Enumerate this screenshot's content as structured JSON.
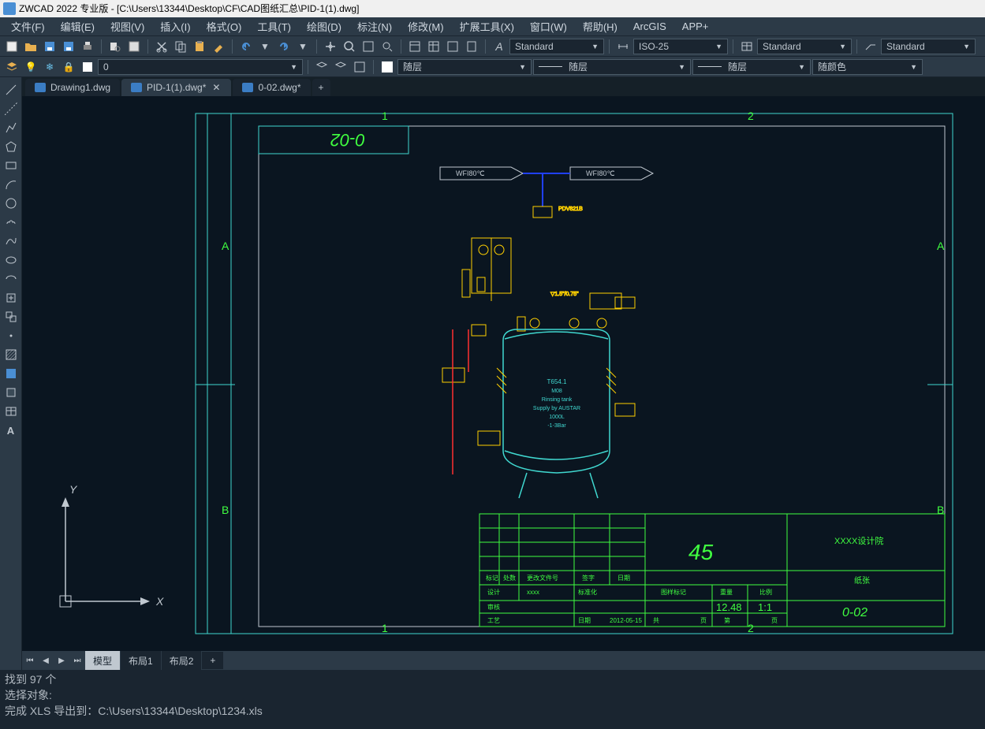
{
  "title": "ZWCAD 2022 专业版 - [C:\\Users\\13344\\Desktop\\CF\\CAD图纸汇总\\PID-1(1).dwg]",
  "menu": {
    "file": "文件(F)",
    "edit": "编辑(E)",
    "view": "视图(V)",
    "insert": "插入(I)",
    "format": "格式(O)",
    "tools": "工具(T)",
    "draw": "绘图(D)",
    "dimension": "标注(N)",
    "modify": "修改(M)",
    "extension": "扩展工具(X)",
    "window": "窗口(W)",
    "help": "帮助(H)",
    "arcgis": "ArcGIS",
    "app": "APP+"
  },
  "style_combos": {
    "text_style": "Standard",
    "dim_style": "ISO-25",
    "table_style": "Standard",
    "mleader_style": "Standard"
  },
  "layer_value": "0",
  "layer_combos": {
    "prop1": "随层",
    "prop2": "随层",
    "prop3": "随层",
    "prop4": "随颜色"
  },
  "doc_tabs": [
    {
      "name": "Drawing1.dwg",
      "active": false,
      "close": false
    },
    {
      "name": "PID-1(1).dwg*",
      "active": true,
      "close": true
    },
    {
      "name": "0-02.dwg*",
      "active": false,
      "close": false
    }
  ],
  "layout_tabs": {
    "model": "模型",
    "layout1": "布局1",
    "layout2": "布局2"
  },
  "cmd": {
    "l1": "找到 97 个",
    "l2": "选择对象:",
    "l3": "完成 XLS 导出到：C:\\Users\\13344\\Desktop\\1234.xls"
  },
  "drawing": {
    "sheet_no": "0-02",
    "grid_cols": [
      "1",
      "2"
    ],
    "grid_rows": [
      "A",
      "B"
    ],
    "arrows": [
      "WFI80℃",
      "WFI80℃"
    ],
    "valve_lbl1": "PDV821B",
    "size_note": "▽1.5\"/0.75\"",
    "tank": {
      "l1": "T654.1",
      "l2": "M08",
      "l3": "Rinsing tank",
      "l4": "Supply by AUSTAR",
      "l5": "1000L",
      "l6": "-1-3Bar"
    },
    "title_block": {
      "scale": "1:1",
      "weight": "12.48",
      "date": "2012-05-15",
      "sheet_no_big": "45",
      "institute": "XXXX设计院",
      "hdr": [
        "标记",
        "处数",
        "更改文件号",
        "签字",
        "日期"
      ],
      "row1": [
        "设计",
        "xxxx",
        "标准化"
      ],
      "row2": [
        "审核"
      ],
      "row3": [
        "工艺",
        "日期"
      ],
      "right_hdr": [
        "图样标记",
        "重量",
        "比例"
      ],
      "bottom": [
        "共",
        "页",
        "第",
        "页"
      ],
      "sheet_label": "纸张",
      "sheet_no2": "0-02"
    }
  },
  "axes": {
    "x": "X",
    "y": "Y"
  }
}
